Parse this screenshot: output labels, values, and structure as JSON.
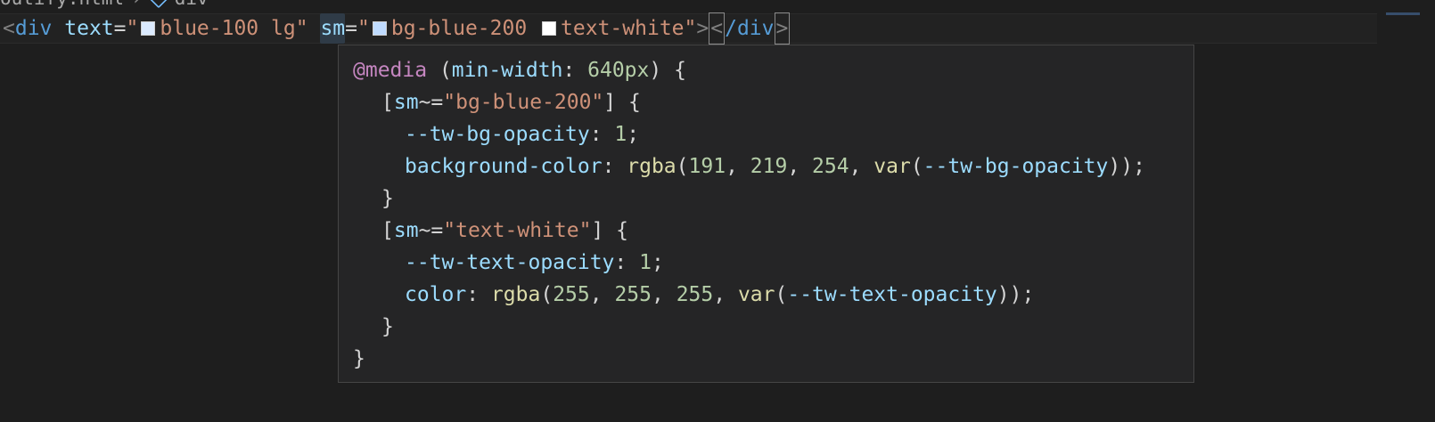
{
  "breadcrumb": {
    "file": "outify.html",
    "separator": "›",
    "element": "div"
  },
  "code_line": {
    "open_bracket": "<",
    "tag": "div",
    "attr1_name": "text",
    "eq": "=",
    "quote": "\"",
    "attr1_value1": "blue-100",
    "attr1_value2": "lg",
    "attr2_name": "sm",
    "attr2_value1": "bg-blue-200",
    "attr2_value2": "text-white",
    "close_bracket": ">",
    "end_open": "<",
    "end_slash_tag": "/div",
    "end_close": ">",
    "swatch_colors": {
      "blue_100": "#dbeafe",
      "blue_200": "#bfdbfe",
      "white": "#ffffff"
    }
  },
  "hover": {
    "media_keyword": "@media",
    "media_open": " (",
    "media_prop": "min-width",
    "media_colon": ": ",
    "media_value": "640px",
    "media_close": ") {",
    "rule1": {
      "sel_open": "[",
      "sel_attr": "sm",
      "sel_op": "~=",
      "sel_value": "\"bg-blue-200\"",
      "sel_close": "] {",
      "decl1_prop": "--tw-bg-opacity",
      "decl1_colon": ": ",
      "decl1_value": "1",
      "decl1_end": ";",
      "decl2_prop": "background-color",
      "decl2_colon": ": ",
      "decl2_fn": "rgba",
      "decl2_p1": "(",
      "decl2_n1": "191",
      "decl2_c1": ", ",
      "decl2_n2": "219",
      "decl2_c2": ", ",
      "decl2_n3": "254",
      "decl2_c3": ", ",
      "decl2_var": "var",
      "decl2_p2": "(",
      "decl2_varname": "--tw-bg-opacity",
      "decl2_end": "));",
      "close": "}"
    },
    "rule2": {
      "sel_open": "[",
      "sel_attr": "sm",
      "sel_op": "~=",
      "sel_value": "\"text-white\"",
      "sel_close": "] {",
      "decl1_prop": "--tw-text-opacity",
      "decl1_colon": ": ",
      "decl1_value": "1",
      "decl1_end": ";",
      "decl2_prop": "color",
      "decl2_colon": ": ",
      "decl2_fn": "rgba",
      "decl2_p1": "(",
      "decl2_n1": "255",
      "decl2_c1": ", ",
      "decl2_n2": "255",
      "decl2_c2": ", ",
      "decl2_n3": "255",
      "decl2_c3": ", ",
      "decl2_var": "var",
      "decl2_p2": "(",
      "decl2_varname": "--tw-text-opacity",
      "decl2_end": "));",
      "close": "}"
    },
    "media_end": "}"
  }
}
